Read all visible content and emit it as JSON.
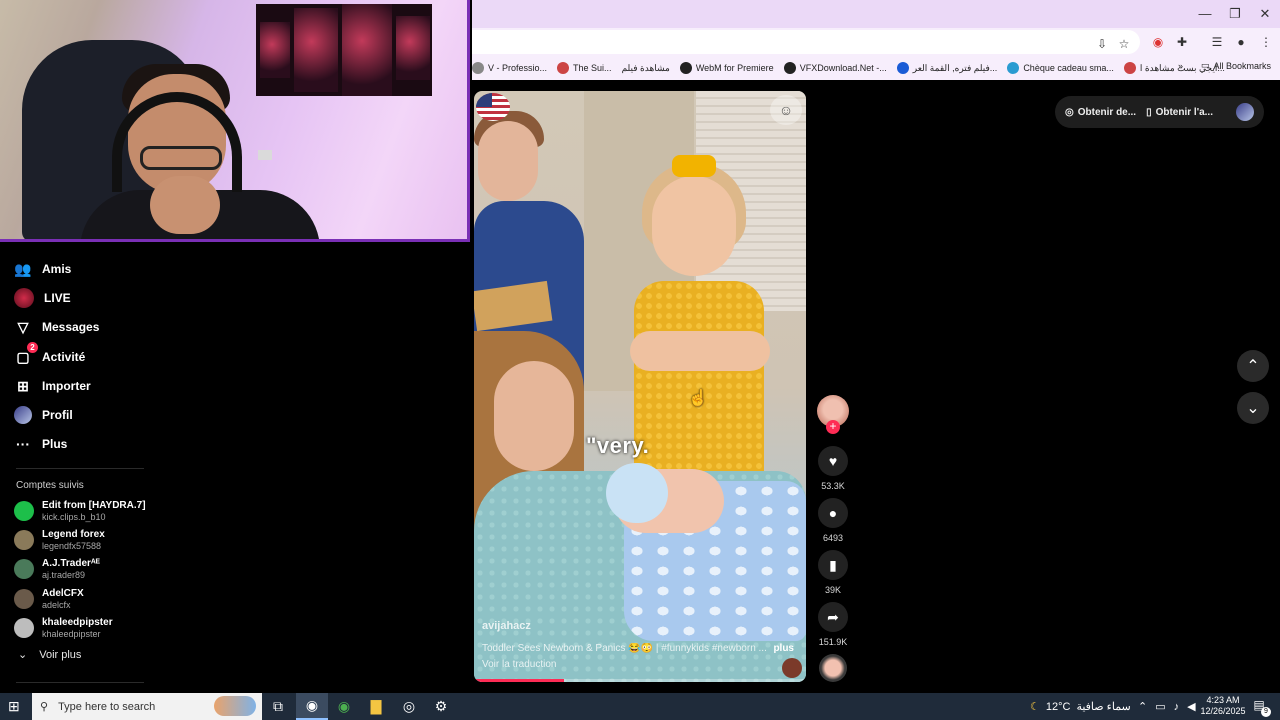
{
  "browser": {
    "bookmarks": [
      {
        "label": "V - Professio...",
        "color": "#888888"
      },
      {
        "label": "The Sui...",
        "color": "#c44"
      },
      {
        "label": "مشاهدة فيلم",
        "color": "#c44"
      },
      {
        "label": "WebM for Premiere",
        "color": "#222"
      },
      {
        "label": "VFXDownload.Net -...",
        "color": "#222"
      },
      {
        "label": "فيلم فتره, القمة العر...",
        "color": "#1a5bd6"
      },
      {
        "label": "Chèque cadeau sma...",
        "color": "#2a9bd1"
      },
      {
        "label": "ايجي بست مشاهدة ا...",
        "color": "#c44"
      }
    ],
    "all_bookmarks": "All Bookmarks"
  },
  "sidebar": {
    "nav": [
      {
        "label": "Amis",
        "icon": "friends-icon"
      },
      {
        "label": "LIVE",
        "icon": "live-icon"
      },
      {
        "label": "Messages",
        "icon": "messages-icon"
      },
      {
        "label": "Activité",
        "icon": "activity-icon",
        "badge": "2"
      },
      {
        "label": "Importer",
        "icon": "upload-icon"
      },
      {
        "label": "Profil",
        "icon": "profile-icon"
      },
      {
        "label": "Plus",
        "icon": "more-icon"
      }
    ],
    "following_title": "Comptes suivis",
    "following": [
      {
        "name": "Edit from [HAYDRA.7]",
        "handle": "kick.clips.b_b10",
        "color": "#1dbf4a"
      },
      {
        "name": "Legend forex",
        "handle": "legendfx57588",
        "color": "#8a7a5a"
      },
      {
        "name": "A.J.Traderᴬᴱ",
        "handle": "aj.trader89",
        "color": "#4a7a5a"
      },
      {
        "name": "AdelCFX",
        "handle": "adelcfx",
        "color": "#6a5a4a"
      },
      {
        "name": "khaleedpipster",
        "handle": "khaleedpipster",
        "color": "#bdbdbd"
      }
    ],
    "see_more": "Voir plus"
  },
  "video": {
    "overlay_text": "\"very.",
    "author": "avijahacz",
    "description": "Toddler Sees Newborn & Panics 😂😳 | #funnykids #newborn ...",
    "more": "plus",
    "translate": "Voir la traduction",
    "progress": 0.27
  },
  "actions": {
    "likes": "53.3K",
    "comments": "6493",
    "saves": "39K",
    "shares": "151.9K"
  },
  "top_right": {
    "get_coins": "Obtenir de...",
    "get_app": "Obtenir l'a..."
  },
  "taskbar": {
    "search_placeholder": "Type here to search",
    "temperature": "12°C",
    "weather": "سماء صافية",
    "time": "4:23 AM",
    "date": "12/26/2025",
    "notifications": "9"
  }
}
